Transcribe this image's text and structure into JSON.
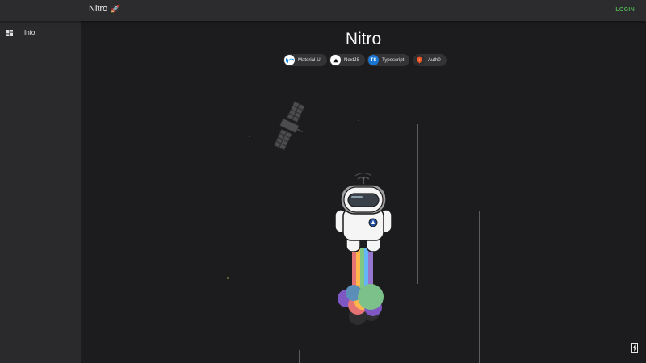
{
  "appbar": {
    "title": "Nitro",
    "title_icon": "rocket-icon",
    "login_label": "LOGIN",
    "login_color": "#4caf50"
  },
  "drawer": {
    "items": [
      {
        "label": "Info",
        "icon": "dashboard-icon"
      }
    ]
  },
  "main": {
    "title": "Nitro",
    "chips": [
      {
        "label": "Material-UI",
        "icon": "material-ui-icon"
      },
      {
        "label": "NextJS",
        "icon": "nextjs-icon"
      },
      {
        "label": "Typescript",
        "icon": "typescript-icon",
        "avatar_text": "TS"
      },
      {
        "label": "Auth0",
        "icon": "auth0-icon"
      }
    ]
  },
  "fab": {
    "icon": "lightning-icon"
  },
  "colors": {
    "background": "#1c1b1d",
    "appbar": "#2c2b2d",
    "drawer": "#2a292b",
    "accent": "#4caf50"
  }
}
